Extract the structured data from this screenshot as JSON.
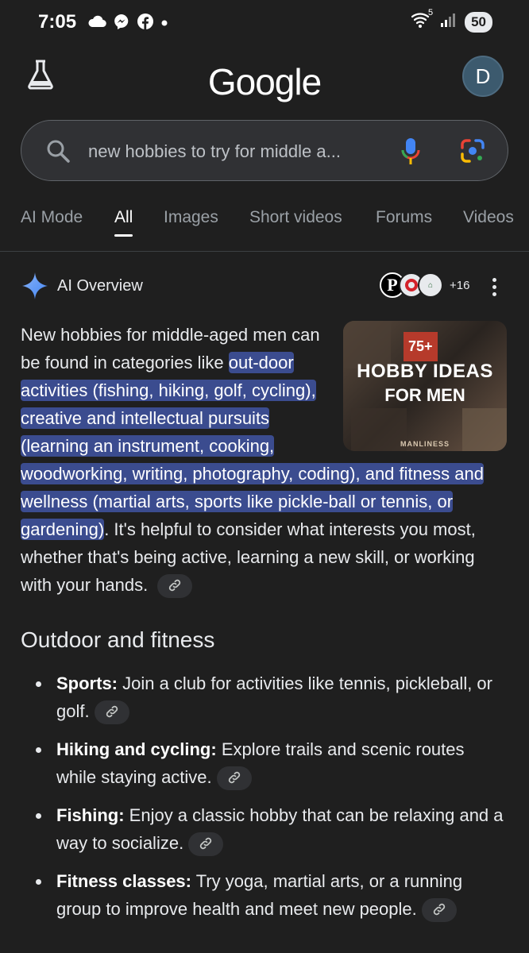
{
  "status_bar": {
    "time": "7:05",
    "left_icons": [
      "cloud-icon",
      "messenger-icon",
      "facebook-icon",
      "dot-icon"
    ],
    "right_icons": [
      "wifi-icon",
      "signal-icon"
    ],
    "wifi_label": "5",
    "battery": "50"
  },
  "header": {
    "logo": "Google",
    "avatar_letter": "D",
    "labs_icon": "flask-icon"
  },
  "search": {
    "query": "new hobbies to try for middle a..."
  },
  "tabs": [
    {
      "label": "AI Mode",
      "active": false
    },
    {
      "label": "All",
      "active": true
    },
    {
      "label": "Images",
      "active": false
    },
    {
      "label": "Short videos",
      "active": false
    },
    {
      "label": "Forums",
      "active": false
    },
    {
      "label": "Videos",
      "active": false
    }
  ],
  "ai_overview": {
    "title": "AI Overview",
    "sources_more": "+16",
    "summary_intro": "New hobbies for middle-aged men can be found in categories like ",
    "summary_highlight": "out-door activities (fishing, hiking, golf, cycling), creative and intellectual pursuits (learning an instrument, cooking, woodworking, writing, photography, coding), and fitness and wellness (martial arts, sports like pickle-ball or tennis, or gardening)",
    "summary_rest": ". It's helpful to consider what interests you most, whether that's being active, learning a new skill, or working with your hands.",
    "thumbnail": {
      "badge": "75+",
      "line1": "HOBBY IDEAS",
      "line2": "FOR MEN",
      "footer": "MANLINESS"
    }
  },
  "section": {
    "heading": "Outdoor and fitness",
    "items": [
      {
        "term": "Sports:",
        "text": " Join a club for activities like tennis, pickleball, or golf."
      },
      {
        "term": "Hiking and cycling:",
        "text": " Explore trails and scenic routes while staying active."
      },
      {
        "term": "Fishing:",
        "text": " Enjoy a classic hobby that can be relaxing and a way to socialize."
      },
      {
        "term": "Fitness classes:",
        "text": " Try yoga, martial arts, or a running group to improve health and meet new people."
      }
    ]
  },
  "colors": {
    "background": "#1f1f1f",
    "highlight": "#3b4c8f",
    "search_bg": "#303134"
  }
}
